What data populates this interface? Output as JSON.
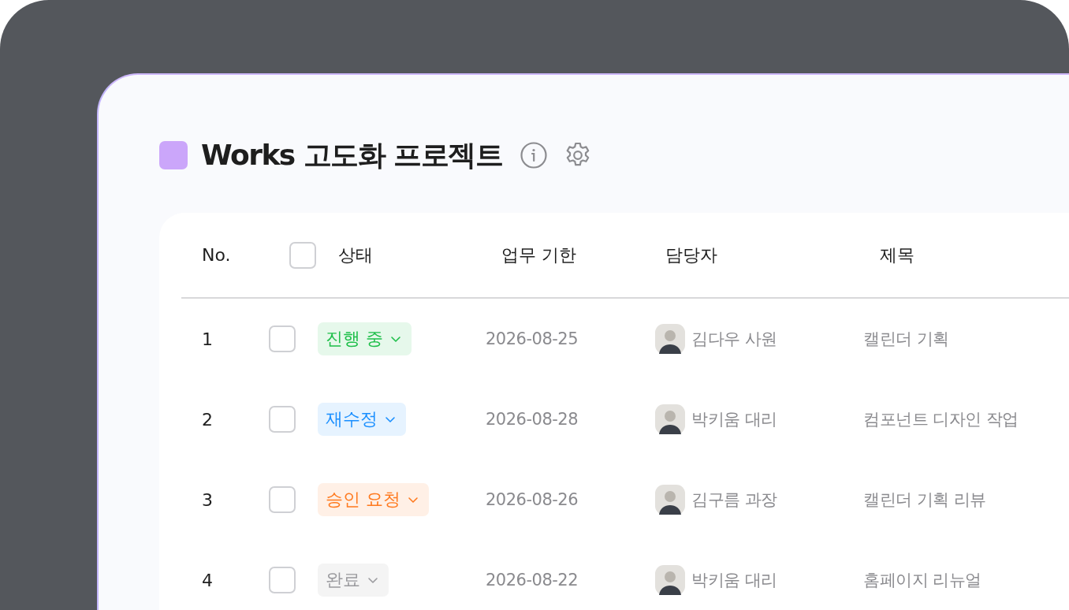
{
  "project": {
    "title": "Works 고도화 프로젝트"
  },
  "table": {
    "columns": [
      "No.",
      "상태",
      "업무 기한",
      "담당자",
      "제목"
    ],
    "select_all": {
      "checked": false
    },
    "rows": [
      {
        "no": "1",
        "checked": false,
        "status": {
          "label": "진행 중",
          "color": "#1fbf4a"
        },
        "due": "2026-08-25",
        "assignee": "김다우 사원",
        "title": "캘린더 기획"
      },
      {
        "no": "2",
        "checked": false,
        "status": {
          "label": "재수정",
          "color": "#1a8fff"
        },
        "due": "2026-08-28",
        "assignee": "박키움 대리",
        "title": "컴포넌트 디자인 작업"
      },
      {
        "no": "3",
        "checked": false,
        "status": {
          "label": "승인 요청",
          "color": "#ff7a1f"
        },
        "due": "2026-08-26",
        "assignee": "김구름 과장",
        "title": "캘린더 기획 리뷰"
      },
      {
        "no": "4",
        "checked": false,
        "status": {
          "label": "완료",
          "color": "#9a9a9e"
        },
        "due": "2026-08-22",
        "assignee": "박키움 대리",
        "title": "홈페이지 리뉴얼"
      }
    ]
  }
}
